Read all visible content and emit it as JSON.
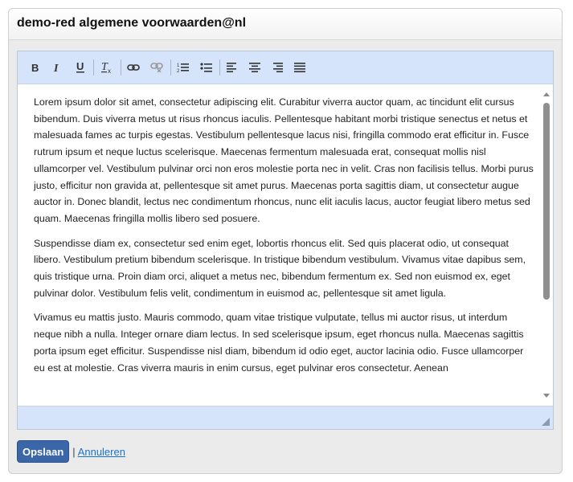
{
  "panel": {
    "title": "demo-red algemene voorwaarden@nl"
  },
  "toolbar": {
    "buttons": [
      {
        "name": "bold-icon"
      },
      {
        "name": "italic-icon"
      },
      {
        "name": "underline-icon"
      },
      {
        "name": "remove-format-icon"
      },
      {
        "name": "link-icon"
      },
      {
        "name": "unlink-icon"
      },
      {
        "name": "numbered-list-icon"
      },
      {
        "name": "bulleted-list-icon"
      },
      {
        "name": "align-left-icon"
      },
      {
        "name": "align-center-icon"
      },
      {
        "name": "align-right-icon"
      },
      {
        "name": "align-justify-icon"
      }
    ]
  },
  "editor": {
    "paragraphs": [
      "Lorem ipsum dolor sit amet, consectetur adipiscing elit. Curabitur viverra auctor quam, ac tincidunt elit cursus bibendum. Duis viverra metus ut risus rhoncus iaculis. Pellentesque habitant morbi tristique senectus et netus et malesuada fames ac turpis egestas. Vestibulum pellentesque lacus nisi, fringilla commodo erat efficitur in. Fusce rutrum ipsum et neque luctus scelerisque. Maecenas fermentum malesuada erat, consequat mollis nisl ullamcorper vel. Vestibulum pulvinar orci non eros molestie porta nec in velit. Cras non facilisis tellus. Morbi purus justo, efficitur non gravida at, pellentesque sit amet purus. Maecenas porta sagittis diam, ut consectetur augue auctor in. Donec blandit, lectus nec condimentum rhoncus, nunc elit iaculis lacus, auctor feugiat libero metus sed quam. Maecenas fringilla mollis libero sed posuere.",
      "Suspendisse diam ex, consectetur sed enim eget, lobortis rhoncus elit. Sed quis placerat odio, ut consequat libero. Vestibulum pretium bibendum scelerisque. In tristique bibendum vestibulum. Vivamus vitae dapibus sem, quis tristique urna. Proin diam orci, aliquet a metus nec, bibendum fermentum ex. Sed non euismod ex, eget pulvinar dolor. Vestibulum felis velit, condimentum in euismod ac, pellentesque sit amet ligula.",
      "Vivamus eu mattis justo. Mauris commodo, quam vitae tristique vulputate, tellus mi auctor risus, ut interdum neque nibh a nulla. Integer ornare diam lectus. In sed scelerisque ipsum, eget rhoncus nulla. Maecenas sagittis porta ipsum eget efficitur. Suspendisse nisl diam, bibendum id odio eget, auctor lacinia odio. Fusce ullamcorper eu est at molestie. Cras viverra mauris in enim cursus, eget pulvinar eros consectetur. Aenean"
    ]
  },
  "actions": {
    "save_label": "Opslaan",
    "separator": "|",
    "cancel_label": "Annuleren"
  },
  "colors": {
    "toolbar_bg": "#d6e4fb",
    "save_button_bg": "#3b66a8",
    "cancel_link": "#1a73c7"
  }
}
